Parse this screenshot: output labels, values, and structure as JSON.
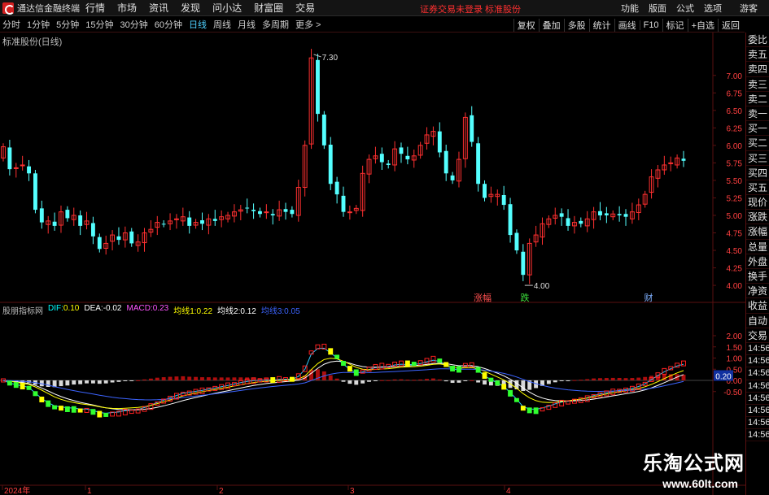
{
  "app": {
    "title": "通达信金融终端",
    "menu": [
      "行情",
      "市场",
      "资讯",
      "发现",
      "问小达",
      "财富圈",
      "交易"
    ],
    "notice": "证券交易未登录  标准股份",
    "right_menu": [
      "功能",
      "版面",
      "公式",
      "选项"
    ],
    "guest": "游客"
  },
  "periods": [
    {
      "label": "分时",
      "active": false
    },
    {
      "label": "1分钟",
      "active": false
    },
    {
      "label": "5分钟",
      "active": false
    },
    {
      "label": "15分钟",
      "active": false
    },
    {
      "label": "30分钟",
      "active": false
    },
    {
      "label": "60分钟",
      "active": false
    },
    {
      "label": "日线",
      "active": true
    },
    {
      "label": "周线",
      "active": false
    },
    {
      "label": "月线",
      "active": false
    },
    {
      "label": "多周期",
      "active": false
    },
    {
      "label": "更多 >",
      "active": false
    }
  ],
  "tools": [
    "复权",
    "叠加",
    "多股",
    "统计",
    "画线",
    "F10",
    "标记",
    "+自选",
    "返回"
  ],
  "chart": {
    "title": "标准股份(日线)",
    "price_ticks": [
      "7.00",
      "6.75",
      "6.50",
      "6.25",
      "6.00",
      "5.75",
      "5.50",
      "5.25",
      "5.00",
      "4.75",
      "4.50",
      "4.25",
      "4.00"
    ],
    "high_label": "7.30",
    "low_label": "4.00",
    "events": [
      {
        "label": "涨幅",
        "color": "#ff5050"
      },
      {
        "label": "跌",
        "color": "#3ce03c"
      },
      {
        "label": "财",
        "color": "#7fb0ff"
      }
    ],
    "x_labels": [
      "2024年",
      "1",
      "2",
      "3",
      "4"
    ]
  },
  "indicator": {
    "name": "股朋指标网",
    "items": [
      {
        "k": "DIF:",
        "v": "0.10",
        "c": "#ffffff"
      },
      {
        "k": "DEA:",
        "v": "-0.02",
        "c": "#ffff00"
      },
      {
        "k": "MACD:",
        "v": "0.23",
        "c": "#ff00ff"
      },
      {
        "k": "均线1:",
        "v": "0.22",
        "c": "#00ff00"
      },
      {
        "k": "均线2:",
        "v": "0.12",
        "c": "#ffffff"
      },
      {
        "k": "均线3:",
        "v": "0.05",
        "c": "#3c64ff"
      }
    ],
    "ticks": [
      "2.00",
      "1.50",
      "1.00",
      "0.50",
      "0.00",
      "-0.50"
    ],
    "current": "0.20"
  },
  "right_panel": {
    "items": [
      "委比",
      "卖五",
      "卖四",
      "卖三",
      "卖二",
      "卖一",
      "买一",
      "买二",
      "买三",
      "买四",
      "买五",
      "现价",
      "涨跌",
      "涨幅",
      "总量",
      "外盘",
      "换手",
      "净资",
      "收益",
      "自动",
      "交易"
    ],
    "times": [
      "14:56",
      "14:56",
      "14:56",
      "14:56",
      "14:56",
      "14:56",
      "14:56",
      "14:56"
    ]
  },
  "watermark": {
    "main": "乐淘公式网",
    "sub": "www.60lt.com"
  },
  "colors": {
    "up": "#ff3030",
    "down": "#54ffff",
    "grid": "#5a1010",
    "bg": "#000000"
  }
}
